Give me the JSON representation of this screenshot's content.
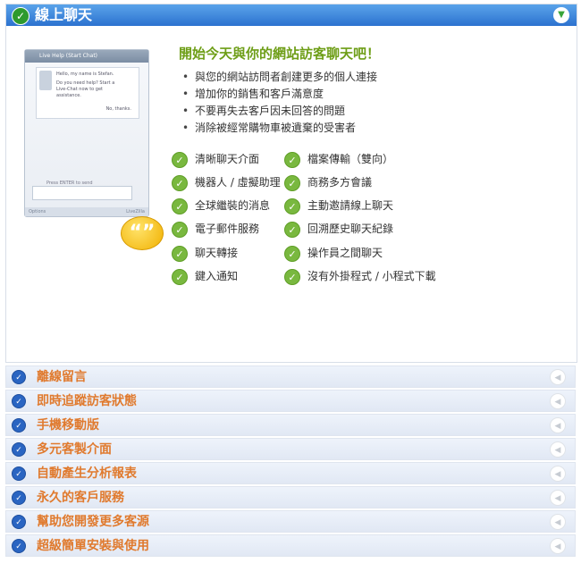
{
  "header": {
    "title": "線上聊天",
    "status_icon": "check-circle-icon",
    "collapse_icon": "chevron-down-icon"
  },
  "preview": {
    "window_title": "Live Help (Start Chat)",
    "greeting": "Hello, my name is Stefan.",
    "question_line1": "Do you need help? Start a",
    "question_line2": "Live-Chat now to get",
    "question_line3": "assistance.",
    "no_thanks": "No, thanks.",
    "send_hint": "Press ENTER to send",
    "footer_left": "Options",
    "footer_right": "LiveZilla",
    "bubble_text": "“”"
  },
  "main": {
    "title": "開始今天與你的網站訪客聊天吧！",
    "bullets": [
      "與您的網站訪問者創建更多的個人連接",
      "增加你的銷售和客戶滿意度",
      "不要再失去客戶因未回答的問題",
      "消除被經常購物車被遺棄的受害者"
    ],
    "features_left": [
      "清晰聊天介面",
      "機器人 / 虛擬助理",
      "全球繼裝的消息",
      "電子郵件服務",
      "聊天轉接",
      "鍵入通知"
    ],
    "features_right": [
      "檔案傳輸（雙向）",
      "商務多方會議",
      "主動邀請線上聊天",
      "回溯歷史聊天紀錄",
      "操作員之間聊天",
      "沒有外掛程式 / 小程式下載"
    ]
  },
  "sections": [
    {
      "label": "離線留言"
    },
    {
      "label": "即時追蹤訪客狀態"
    },
    {
      "label": "手機移動版"
    },
    {
      "label": "多元客製介面"
    },
    {
      "label": "自動產生分析報表"
    },
    {
      "label": "永久的客戶服務"
    },
    {
      "label": "幫助您開發更多客源"
    },
    {
      "label": "超級簡單安裝與使用"
    }
  ],
  "colors": {
    "header_blue": "#2c72cf",
    "title_green": "#6e9e17",
    "section_orange": "#e07a2e",
    "check_green": "#79b83f"
  }
}
